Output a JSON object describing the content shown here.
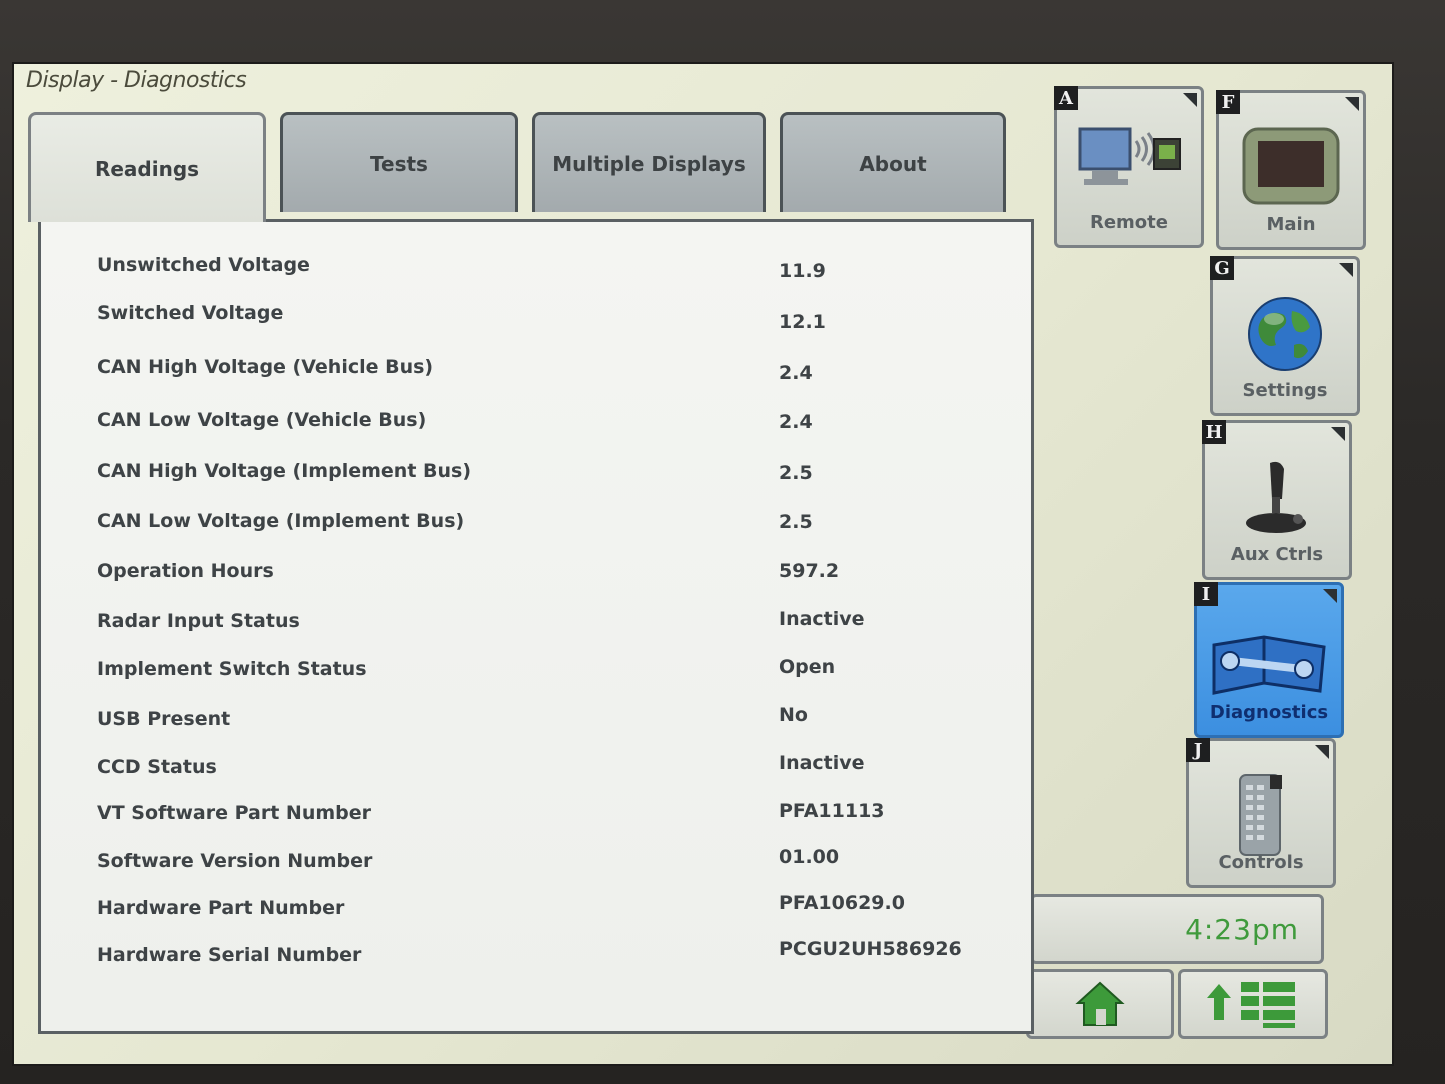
{
  "window": {
    "title": "Display - Diagnostics"
  },
  "tabs": [
    {
      "label": "Readings",
      "active": true
    },
    {
      "label": "Tests",
      "active": false
    },
    {
      "label": "Multiple Displays",
      "active": false
    },
    {
      "label": "About",
      "active": false
    }
  ],
  "readings": [
    {
      "label": "Unswitched Voltage",
      "value": "11.9"
    },
    {
      "label": "Switched Voltage",
      "value": "12.1"
    },
    {
      "label": "CAN High Voltage (Vehicle Bus)",
      "value": "2.4"
    },
    {
      "label": "CAN Low Voltage (Vehicle Bus)",
      "value": "2.4"
    },
    {
      "label": "CAN High Voltage (Implement Bus)",
      "value": "2.5"
    },
    {
      "label": "CAN Low Voltage (Implement Bus)",
      "value": "2.5"
    },
    {
      "label": "Operation Hours",
      "value": "597.2"
    },
    {
      "label": "Radar Input Status",
      "value": "Inactive"
    },
    {
      "label": "Implement Switch Status",
      "value": "Open"
    },
    {
      "label": "USB Present",
      "value": "No"
    },
    {
      "label": "CCD Status",
      "value": "Inactive"
    },
    {
      "label": "VT Software Part Number",
      "value": "PFA11113"
    },
    {
      "label": "Software Version Number",
      "value": "01.00"
    },
    {
      "label": "Hardware Part Number",
      "value": "PFA10629.0"
    },
    {
      "label": "Hardware Serial Number",
      "value": "PCGU2UH586926"
    }
  ],
  "sidebar": {
    "buttons": [
      {
        "key": "A",
        "label": "Remote",
        "icon": "remote-icon",
        "active": false
      },
      {
        "key": "F",
        "label": "Main",
        "icon": "display-icon",
        "active": false
      },
      {
        "key": "G",
        "label": "Settings",
        "icon": "globe-icon",
        "active": false
      },
      {
        "key": "H",
        "label": "Aux Ctrls",
        "icon": "joystick-icon",
        "active": false
      },
      {
        "key": "I",
        "label": "Diagnostics",
        "icon": "wrench-book-icon",
        "active": true
      },
      {
        "key": "J",
        "label": "Controls",
        "icon": "keypad-icon",
        "active": false
      }
    ]
  },
  "status": {
    "time": "4:23pm"
  },
  "colors": {
    "active_button": "#3c8fe0",
    "clock_text": "#3f9a3c"
  }
}
